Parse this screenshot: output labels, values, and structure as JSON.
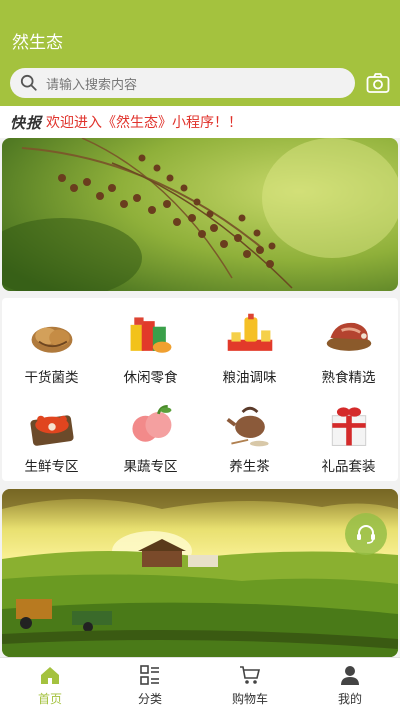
{
  "header": {
    "title": "然生态",
    "search_placeholder": "请输入搜索内容"
  },
  "ticker": {
    "tag": "快报",
    "message": "欢迎进入《然生态》小程序！！"
  },
  "categories": [
    {
      "label": "干货菌类"
    },
    {
      "label": "休闲零食"
    },
    {
      "label": "粮油调味"
    },
    {
      "label": "熟食精选"
    },
    {
      "label": "生鲜专区"
    },
    {
      "label": "果蔬专区"
    },
    {
      "label": "养生茶"
    },
    {
      "label": "礼品套装"
    }
  ],
  "tabbar": {
    "items": [
      {
        "label": "首页",
        "active": true
      },
      {
        "label": "分类",
        "active": false
      },
      {
        "label": "购物车",
        "active": false
      },
      {
        "label": "我的",
        "active": false
      }
    ]
  },
  "colors": {
    "brand": "#a4c23e",
    "ticker_text": "#e0322b"
  }
}
